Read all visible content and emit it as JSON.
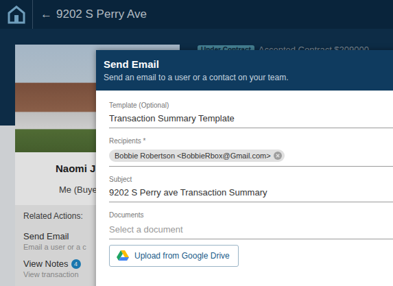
{
  "header": {
    "back_icon": "←",
    "title": "9202 S Perry Ave"
  },
  "status": {
    "badge": "Under Contract",
    "text": "Accepted Contract $209000"
  },
  "card": {
    "name": "Naomi J",
    "role": "Me (Buye",
    "related_label": "Related Actions:",
    "actions": [
      {
        "title": "Send Email",
        "subtitle": "Email a user or a c"
      },
      {
        "title": "View Notes",
        "subtitle": "View transaction",
        "badge": "4"
      }
    ]
  },
  "dialog": {
    "title": "Send Email",
    "subtitle": "Send an email to a user or a contact on your team.",
    "fields": [
      {
        "kind": "text",
        "label": "Template (Optional)",
        "value": "Transaction Summary Template"
      },
      {
        "kind": "chips",
        "label": "Recipients *",
        "chips": [
          "Bobbie Robertson <BobbieRbox@Gmail.com>"
        ]
      },
      {
        "kind": "text",
        "label": "Subject",
        "value": "9202 S Perry ave Transaction Summary"
      },
      {
        "kind": "select",
        "label": "Documents",
        "placeholder": "Select a document"
      }
    ],
    "upload_button": "Upload from Google Drive"
  }
}
